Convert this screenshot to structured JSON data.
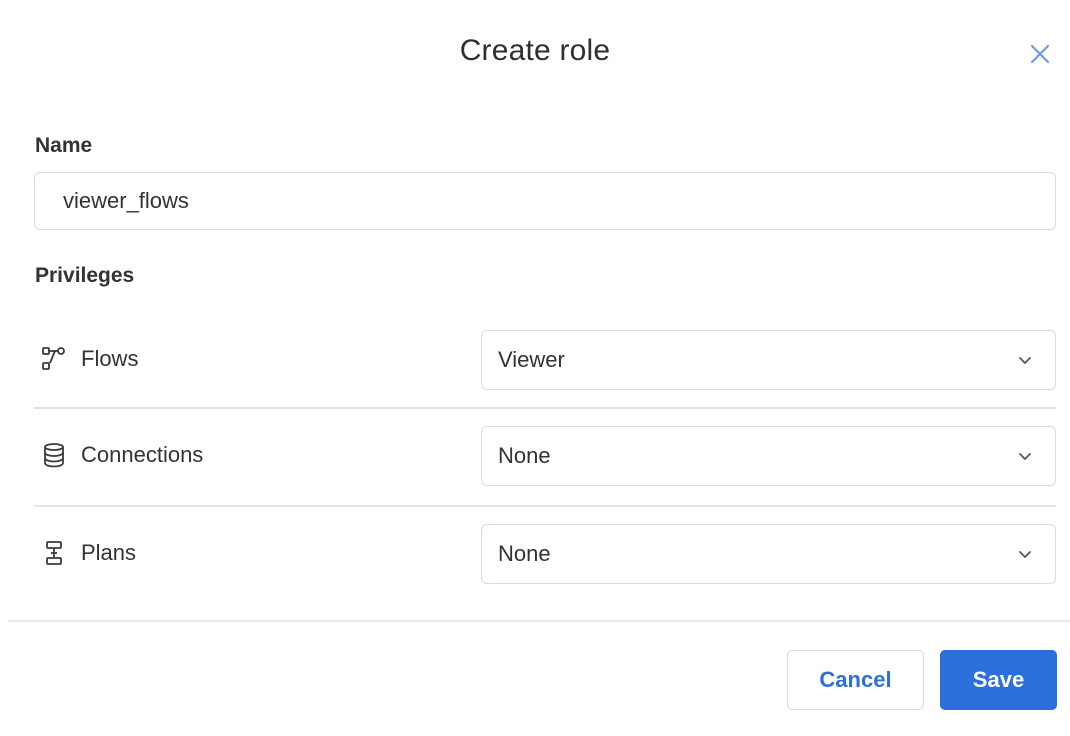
{
  "dialog": {
    "title": "Create role",
    "close_icon": "close-icon"
  },
  "name": {
    "label": "Name",
    "value": "viewer_flows"
  },
  "privileges": {
    "label": "Privileges",
    "rows": [
      {
        "name": "Flows",
        "icon": "flows-icon",
        "value": "Viewer"
      },
      {
        "name": "Connections",
        "icon": "database-icon",
        "value": "None"
      },
      {
        "name": "Plans",
        "icon": "plans-icon",
        "value": "None"
      }
    ]
  },
  "footer": {
    "cancel_label": "Cancel",
    "save_label": "Save"
  },
  "colors": {
    "accent": "#2a6fdb",
    "border": "#d5dbe3",
    "text": "#333333"
  }
}
